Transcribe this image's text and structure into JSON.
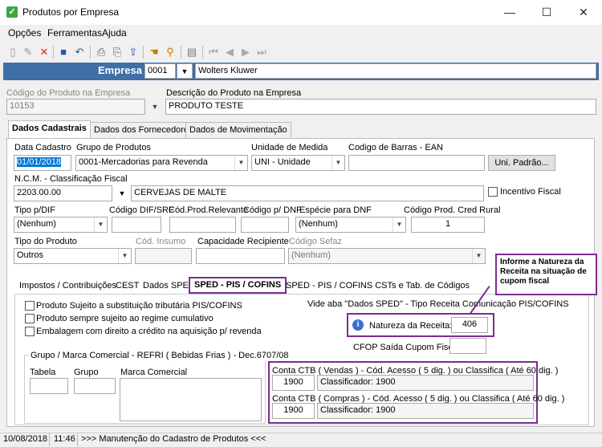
{
  "window": {
    "title": "Produtos por Empresa"
  },
  "menu": [
    "Opções",
    "Ferramentas",
    "Ajuda"
  ],
  "empresa": {
    "label": "Empresa",
    "code": "0001",
    "name": "Wolters Kluwer"
  },
  "header": {
    "codigo_label": "Código do Produto na Empresa",
    "codigo_value": "10153",
    "descricao_label": "Descrição do Produto na Empresa",
    "descricao_value": "PRODUTO TESTE"
  },
  "tabs": [
    "Dados Cadastrais",
    "Dados dos Fornecedores",
    "Dados de Movimentação"
  ],
  "dados": {
    "data_cadastro_label": "Data Cadastro",
    "data_cadastro_value": "01/01/2018",
    "grupo_label": "Grupo de Produtos",
    "grupo_value": "0001-Mercadorias para Revenda",
    "unidade_label": "Unidade de Medida",
    "unidade_value": "UNI - Unidade",
    "ean_label": "Codigo de Barras - EAN",
    "ean_value": "",
    "uni_padrao_button": "Uni. Padrão...",
    "ncm_label": "N.C.M. -  Classificação Fiscal",
    "ncm_value": "2203.00.00",
    "ncm_desc": "CERVEJAS DE MALTE",
    "incentivo_label": "Incentivo Fiscal",
    "tipo_dif_label": "Tipo p/DIF",
    "tipo_dif_value": "(Nenhum)",
    "codigo_dif_label": "Código DIF/SRF",
    "cod_prod_relevante_label": "Cód.Prod.Relevante",
    "codigo_dnf_label": "Código p/ DNF",
    "especie_dnf_label": "Espécie para DNF",
    "especie_dnf_value": "(Nenhum)",
    "cod_cred_rural_label": "Código Prod. Cred Rural",
    "cod_cred_rural_value": "1",
    "tipo_produto_label": "Tipo do Produto",
    "tipo_produto_value": "Outros",
    "cod_insumo_label": "Cód. Insumo",
    "capacidade_label": "Capacidade Recipiente",
    "codigo_sefaz_label": "Código Sefaz",
    "codigo_sefaz_value": "(Nenhum)"
  },
  "subtabs": [
    "Impostos / Contribuições",
    "CEST",
    "Dados SPED",
    "SPED - PIS / COFINS",
    "SPED - PIS / COFINS CSTs e Tab. de Códigos"
  ],
  "sped": {
    "chk1": "Produto Sujeito a substituição tributária PIS/COFINS",
    "chk2": "Produto sempre sujeito ao regime cumulativo",
    "chk3": "Embalagem com direito a crédito na aquisição p/ revenda",
    "vide_text": "Vide aba \"Dados SPED\" - Tipo Receita Comunicação PIS/COFINS",
    "natureza_label": "Natureza da Receita:",
    "natureza_value": "406",
    "cfop_label": "CFOP Saída Cupom Fiscal:",
    "grupo_title": "Grupo / Marca Comercial - REFRI ( Bebidas Frias ) - Dec.6707/08",
    "tabela_label": "Tabela",
    "grupo_label": "Grupo",
    "marca_label": "Marca Comercial",
    "conta_vendas_label": "Conta CTB ( Vendas ) - Cód. Acesso ( 5 dig. ) ou Classifica ( Até 60 dig. )",
    "conta_vendas_value": "1900",
    "conta_vendas_class": "Classificador: 1900",
    "conta_compras_label": "Conta CTB ( Compras ) - Cód. Acesso ( 5 dig. ) ou Classifica ( Até 60 dig. )",
    "conta_compras_value": "1900",
    "conta_compras_class": "Classificador: 1900"
  },
  "callout": "Informe a Natureza da Receita na situação de cupom fiscal",
  "status": {
    "date": "10/08/2018",
    "time": "11:46",
    "message": ">>> Manutenção do Cadastro de Produtos <<<"
  },
  "colors": {
    "empresa_bar": "#3e6fa6",
    "highlight": "#7b2d8e",
    "selection": "#0078d7"
  }
}
